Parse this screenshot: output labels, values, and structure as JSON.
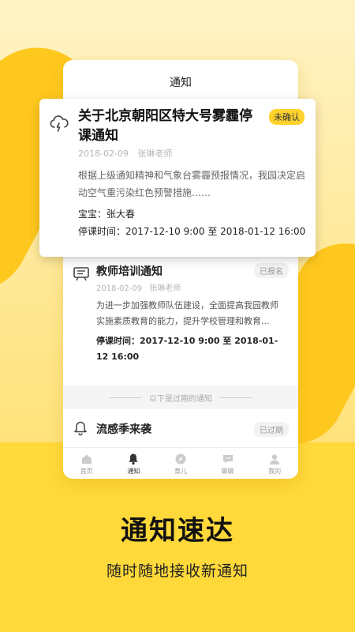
{
  "screen": {
    "title": "通知"
  },
  "featured_notice": {
    "title": "关于北京朝阳区特大号雾霾停课通知",
    "badge": "未确认",
    "date": "2018-02-09",
    "teacher": "张琳老师",
    "body": "根据上级通知精神和气象台雾霾预报情况，我园决定启动空气重污染红色预警措施……",
    "kid_label": "宝宝：张大春",
    "time_label": "停课时间：",
    "time_value": "2017-12-10 9:00 至 2018-01-12 16:00"
  },
  "notice2": {
    "title": "教师培训通知",
    "badge": "已报名",
    "date": "2018-02-09",
    "teacher": "张琳老师",
    "body": "为进一步加强教师队伍建设，全面提高我园教师实施素质教育的能力，提升学校管理和教育...",
    "time_label": "停课时间：",
    "time_value": "2017-12-10 9:00 至 2018-01-12 16:00"
  },
  "expired_divider": "以下是过期的通知",
  "notice3": {
    "title": "流感季来袭",
    "badge": "已过期"
  },
  "tabs": [
    {
      "label": "首页",
      "icon": "home-icon"
    },
    {
      "label": "通知",
      "icon": "bell-icon"
    },
    {
      "label": "育儿",
      "icon": "compass-icon"
    },
    {
      "label": "聊聊",
      "icon": "chat-icon"
    },
    {
      "label": "我的",
      "icon": "profile-icon"
    }
  ],
  "marketing": {
    "headline": "通知速达",
    "subline": "随时随地接收新通知"
  },
  "colors": {
    "brand_yellow": "#FFD83A",
    "badge_yellow": "#FFD22E"
  }
}
